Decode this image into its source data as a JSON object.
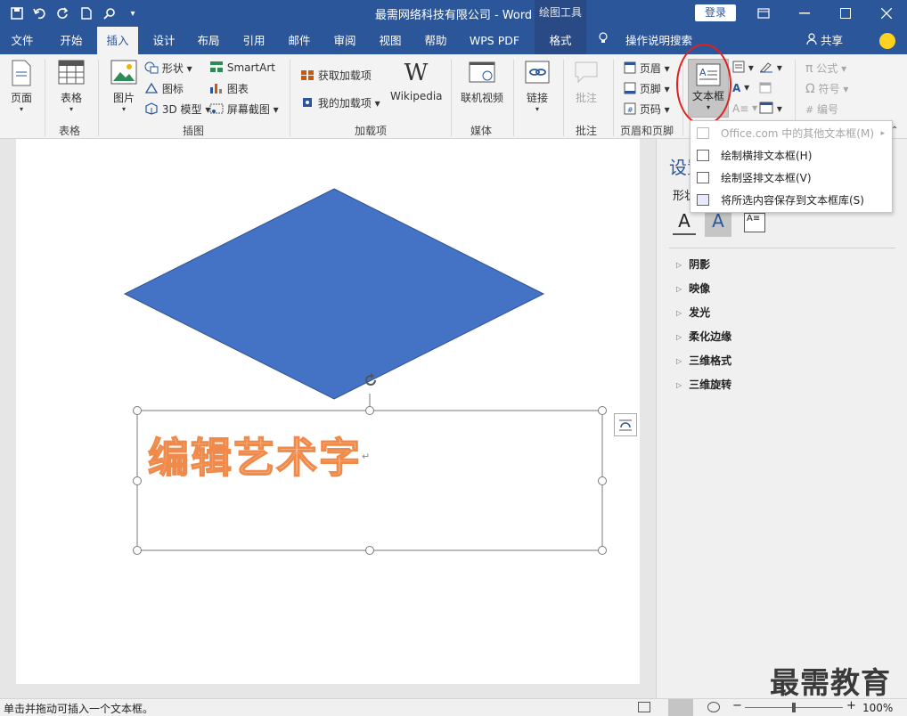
{
  "titlebar": {
    "title": "最需网络科技有限公司  -  Word",
    "context_tools": "绘图工具",
    "login": "登录",
    "bg_color": "#2b579a"
  },
  "tabs": [
    {
      "label": "文件"
    },
    {
      "label": "开始"
    },
    {
      "label": "插入"
    },
    {
      "label": "设计"
    },
    {
      "label": "布局"
    },
    {
      "label": "引用"
    },
    {
      "label": "邮件"
    },
    {
      "label": "审阅"
    },
    {
      "label": "视图"
    },
    {
      "label": "帮助"
    },
    {
      "label": "WPS PDF"
    },
    {
      "label": "格式"
    }
  ],
  "tell_me": "操作说明搜索",
  "share": "共享",
  "ribbon": {
    "pages": "页面",
    "table": "表格",
    "picture": "图片",
    "shapes": "形状",
    "icons": "图标",
    "model3d": "3D 模型",
    "smartart": "SmartArt",
    "chart": "图表",
    "screenshot": "屏幕截图",
    "get_addins": "获取加载项",
    "my_addins": "我的加载项",
    "wikipedia": "Wikipedia",
    "online_video": "联机视频",
    "link": "链接",
    "comment": "批注",
    "header": "页眉",
    "footer": "页脚",
    "page_number": "页码",
    "textbox": "文本框",
    "equation": "公式",
    "symbol": "符号",
    "number": "编号",
    "groups": {
      "table": "表格",
      "illustrations": "插图",
      "addins": "加载项",
      "media": "媒体",
      "comments": "批注",
      "header_footer": "页眉和页脚"
    }
  },
  "dropdown": {
    "items": [
      {
        "label": "Office.com 中的其他文本框(M)",
        "disabled": true
      },
      {
        "label": "绘制横排文本框(H)",
        "disabled": false
      },
      {
        "label": "绘制竖排文本框(V)",
        "disabled": false
      },
      {
        "label": "将所选内容保存到文本框库(S)",
        "disabled": false
      }
    ]
  },
  "document": {
    "wordart_text": "编辑艺术字",
    "diamond_color": "#4472c4",
    "wordart_color": "#f4a97a"
  },
  "pane": {
    "title": "设置",
    "subtitle": "形状",
    "items": [
      "阴影",
      "映像",
      "发光",
      "柔化边缘",
      "三维格式",
      "三维旋转"
    ]
  },
  "status": {
    "text": "单击并拖动可插入一个文本框。",
    "zoom": "100%"
  },
  "watermark": "最需教育"
}
